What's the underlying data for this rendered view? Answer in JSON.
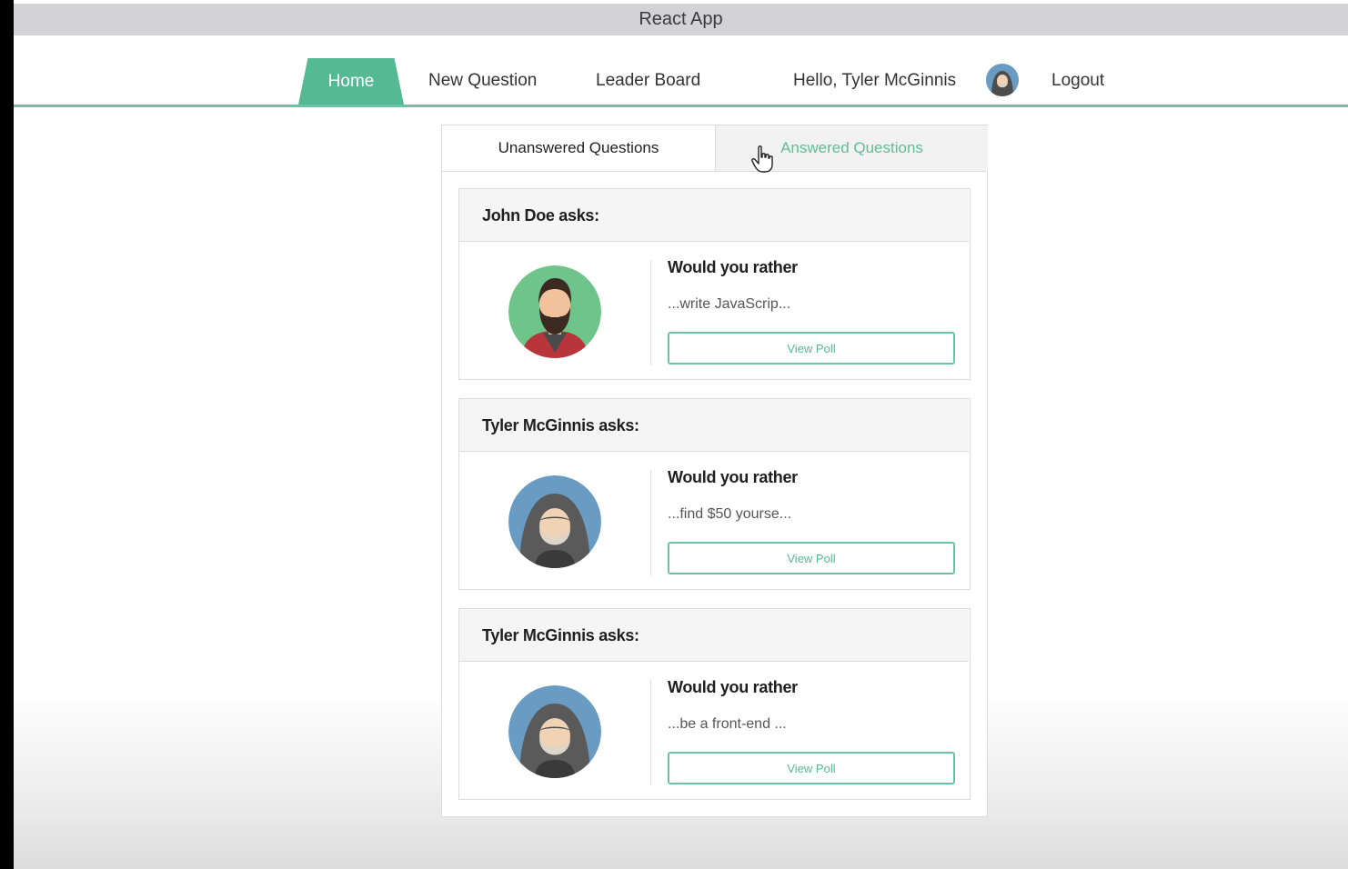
{
  "window": {
    "title": "React App"
  },
  "nav": {
    "home": "Home",
    "new_question": "New Question",
    "leader_board": "Leader Board",
    "greeting": "Hello, Tyler McGinnis",
    "logout": "Logout",
    "accent_color": "#55b993"
  },
  "tabs": {
    "unanswered": "Unanswered Questions",
    "answered": "Answered Questions"
  },
  "questions": [
    {
      "author_line": "John Doe asks:",
      "heading": "Would you rather",
      "snippet": "...write JavaScrip...",
      "button": "View Poll",
      "avatar_icon": "bearded-man-avatar-icon"
    },
    {
      "author_line": "Tyler McGinnis asks:",
      "heading": "Would you rather",
      "snippet": "...find $50 yourse...",
      "button": "View Poll",
      "avatar_icon": "hooded-man-avatar-icon"
    },
    {
      "author_line": "Tyler McGinnis asks:",
      "heading": "Would you rather",
      "snippet": "...be a front-end ...",
      "button": "View Poll",
      "avatar_icon": "hooded-man-avatar-icon"
    }
  ]
}
